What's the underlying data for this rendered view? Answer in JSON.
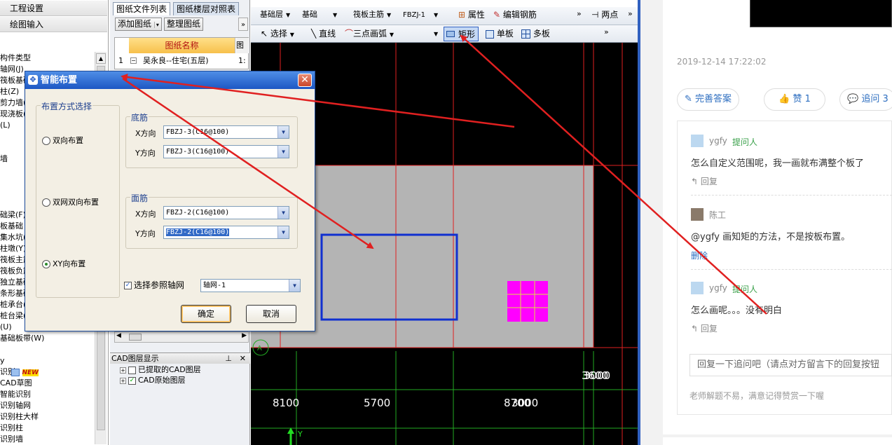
{
  "left_panel": {
    "menu": [
      "工程设置",
      "绘图输入"
    ],
    "tree_items": [
      "构件类型",
      "轴网(J)",
      "筏板基础",
      "柱(Z)",
      "剪力墙(Q)",
      "现浇板(B)",
      "(L)",
      "",
      "",
      "墙",
      "",
      "",
      "",
      "",
      "础梁(F)",
      "板基础",
      "集水坑(K)",
      "柱墩(Y)",
      "筏板主筋",
      "筏板负筋",
      "独立基础",
      "条形基础",
      "桩承台(V)",
      "桩台梁(F)",
      "(U)",
      "基础板带(W)",
      "",
      "y",
      "识别",
      "CAD草图",
      "智能识别",
      "识别轴网",
      "识别柱大样",
      "识别柱",
      "识别墙"
    ],
    "new_badge": "NEW"
  },
  "file_panel": {
    "tabs": [
      "图纸文件列表",
      "图纸楼层对照表"
    ],
    "buttons": [
      "添加图纸",
      "整理图纸"
    ],
    "table_header": "图纸名称",
    "table_header2": "图",
    "row_num": "1",
    "row_name": "吴永良--住宅(五层)",
    "row_extra": "1:",
    "layer_title": "CAD图层显示",
    "layers": [
      "已提取的CAD图层",
      "CAD原始图层"
    ]
  },
  "toolbar1": {
    "layer": "基础层",
    "category": "基础",
    "type": "筏板主筋",
    "item": "FBZJ-1",
    "props": "属性",
    "edit_rebar": "编辑钢筋",
    "two_point": "两点"
  },
  "toolbar2": {
    "select": "选择",
    "line": "直线",
    "arc": "三点画弧",
    "rect": "矩形",
    "single": "单板",
    "multi": "多板"
  },
  "canvas": {
    "labels": [
      "8100",
      "5700",
      "8700",
      "3000",
      "3600",
      "Y"
    ],
    "axis_marker": "A"
  },
  "dialog": {
    "title": "智能布置",
    "layout_group": "布置方式选择",
    "radios": [
      "双向布置",
      "双网双向布置",
      "XY向布置"
    ],
    "bottom_group": "底筋",
    "top_group": "面筋",
    "x_dir": "X方向",
    "y_dir": "Y方向",
    "bottom_x": "FBZJ-3(C16@100)",
    "bottom_y": "FBZJ-3(C16@100)",
    "top_x": "FBZJ-2(C16@100)",
    "top_y": "FBZJ-2(C16@100)",
    "ref_axis_label": "选择参照轴网",
    "ref_axis_value": "轴网-1",
    "ok": "确定",
    "cancel": "取消"
  },
  "qa": {
    "date": "2019-12-14 17:22:02",
    "btn_improve": "完善答案",
    "btn_like": "赞 1",
    "btn_followup": "追问 3",
    "comments": [
      {
        "name": "ygfy",
        "tag": "提问人",
        "text": "怎么自定义范围呢，我一画就布满整个板了",
        "reply": "回复"
      },
      {
        "name": "陈工",
        "tag": "",
        "text": "@ygfy 画知矩的方法，不是按板布置。",
        "reply": "删除"
      },
      {
        "name": "ygfy",
        "tag": "提问人",
        "text": "怎么画呢。。。没有明白",
        "reply": "回复"
      }
    ],
    "reply_placeholder": "回复一下追问吧（请点对方留言下的回复按钮",
    "footnote": "老师解题不易，满意记得赞赏一下喔"
  },
  "colors": {
    "annotation_arrow": "#e02020",
    "grid_red": "#e02020",
    "grid_green": "#22aa22",
    "slab_fill": "#b4b4b4",
    "selection_rect": "#1030d0",
    "column_magenta": "#ff00ff",
    "link_blue": "#2d6ec0"
  }
}
